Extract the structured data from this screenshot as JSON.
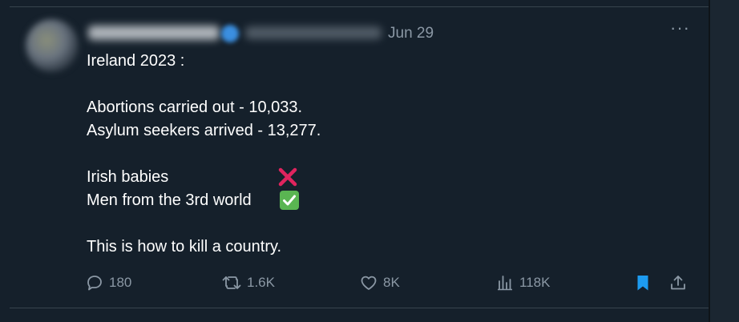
{
  "post": {
    "date": "Jun 29",
    "more_label": "···",
    "lines": {
      "l1": "Ireland 2023 :",
      "l2": "Abortions carried out - 10,033.",
      "l3": "Asylum seekers arrived - 13,277.",
      "l4": "Irish babies",
      "l5": "Men from the 3rd world",
      "l6": "This is how to kill a country."
    },
    "emojis": {
      "after_l4": "cross-mark-icon",
      "after_l5": "check-mark-button-icon"
    }
  },
  "actions": {
    "replies": "180",
    "reposts": "1.6K",
    "likes": "8K",
    "views": "118K"
  },
  "colors": {
    "background": "#15202b",
    "text": "#ffffff",
    "muted": "#8b98a5",
    "bookmark_active": "#1d9bf0",
    "cross": "#e0245e",
    "check": "#5ab552"
  }
}
